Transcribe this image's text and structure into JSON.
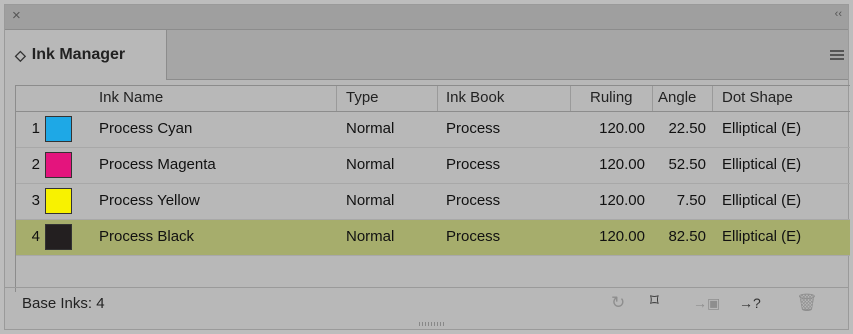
{
  "panel": {
    "close_icon": "×",
    "collapse_icon": "‹‹",
    "tab_label": "Ink Manager",
    "tab_updown_icon": "◇"
  },
  "table": {
    "columns": [
      "Ink Name",
      "Type",
      "Ink Book",
      "Ruling",
      "Angle",
      "Dot Shape"
    ],
    "rows": [
      {
        "num": "1",
        "color": "#1ea8e6",
        "name": "Process Cyan",
        "type": "Normal",
        "book": "Process",
        "ruling": "120.00",
        "angle": "22.50",
        "dot": "Elliptical (E)"
      },
      {
        "num": "2",
        "color": "#e4147d",
        "name": "Process Magenta",
        "type": "Normal",
        "book": "Process",
        "ruling": "120.00",
        "angle": "52.50",
        "dot": "Elliptical (E)"
      },
      {
        "num": "3",
        "color": "#f8f200",
        "name": "Process Yellow",
        "type": "Normal",
        "book": "Process",
        "ruling": "120.00",
        "angle": "7.50",
        "dot": "Elliptical (E)"
      },
      {
        "num": "4",
        "color": "#231f20",
        "name": "Process Black",
        "type": "Normal",
        "book": "Process",
        "ruling": "120.00",
        "angle": "82.50",
        "dot": "Elliptical (E)",
        "selected": true
      }
    ]
  },
  "footer": {
    "base_inks": "Base Inks: 4",
    "icons": [
      "refresh-icon",
      "artboard-icon",
      "move-to-ink-icon",
      "unknown-ink-icon",
      "trash-icon"
    ]
  },
  "colors": {
    "selected_row": "#a6ad6c",
    "panel_bg": "#b8b8b8"
  }
}
